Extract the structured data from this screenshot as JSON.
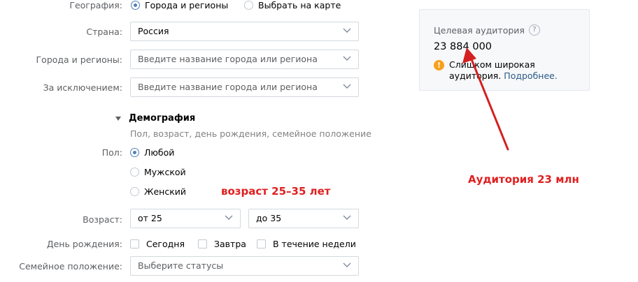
{
  "geography": {
    "label": "География:",
    "options": [
      "Города и регионы",
      "Выбрать на карте"
    ]
  },
  "country": {
    "label": "Страна:",
    "value": "Россия"
  },
  "cities": {
    "label": "Города и регионы:",
    "placeholder": "Введите название города или региона"
  },
  "exclude": {
    "label": "За исключением:",
    "placeholder": "Введите название города или региона"
  },
  "demography": {
    "title": "Демография",
    "subtitle": "Пол, возраст, день рождения, семейное положение"
  },
  "gender": {
    "label": "Пол:",
    "options": [
      "Любой",
      "Мужской",
      "Женский"
    ]
  },
  "age": {
    "label": "Возраст:",
    "from": "от 25",
    "to": "до 35"
  },
  "birthday": {
    "label": "День рождения:",
    "options": [
      "Сегодня",
      "Завтра",
      "В течение недели"
    ]
  },
  "marital": {
    "label": "Семейное положение:",
    "placeholder": "Выберите статусы"
  },
  "audience": {
    "title": "Целевая аудитория",
    "help": "?",
    "count": "23 884 000",
    "warning": "Слишком широкая аудитория.",
    "more_link": "Подробнее."
  },
  "annotations": {
    "age_note": "возраст 25–35 лет",
    "audience_note": "Аудитория 23 млн"
  },
  "colors": {
    "accent": "#5181b8",
    "link": "#2a5885",
    "warning": "#f8a01c",
    "annotation": "#e01f1f"
  }
}
